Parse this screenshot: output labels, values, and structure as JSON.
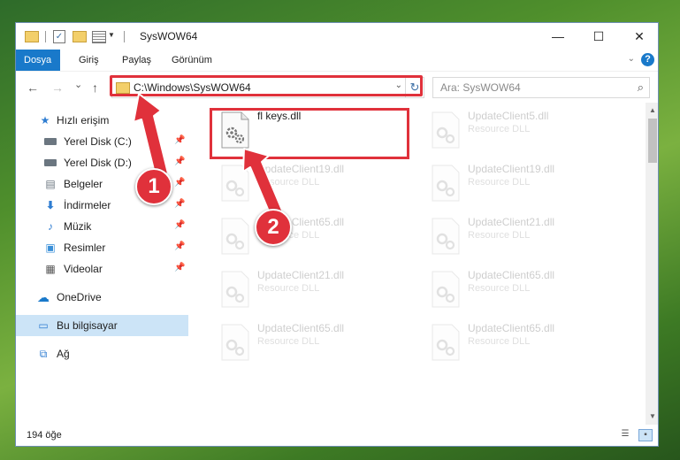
{
  "window": {
    "title": "SysWOW64",
    "controls": {
      "minimize": "—",
      "maximize": "☐",
      "close": "✕"
    }
  },
  "ribbon": {
    "tabs": [
      {
        "label": "Dosya",
        "active": true
      },
      {
        "label": "Giriş"
      },
      {
        "label": "Paylaş"
      },
      {
        "label": "Görünüm"
      }
    ],
    "help": "?"
  },
  "navigation": {
    "back_icon": "←",
    "forward_icon": "→",
    "recent_icon": "⌄",
    "up_icon": "↑",
    "address": "C:\\Windows\\SysWOW64",
    "search_placeholder": "Ara: SysWOW64"
  },
  "sidebar": {
    "items": [
      {
        "label": "Hızlı erişim",
        "icon": "star-icon"
      },
      {
        "label": "Yerel Disk (C:)",
        "icon": "drive-icon",
        "pinned": true
      },
      {
        "label": "Yerel Disk (D:)",
        "icon": "drive-icon",
        "pinned": true
      },
      {
        "label": "Belgeler",
        "icon": "documents-icon",
        "pinned": true
      },
      {
        "label": "İndirmeler",
        "icon": "downloads-icon",
        "pinned": true
      },
      {
        "label": "Müzik",
        "icon": "music-icon",
        "pinned": true
      },
      {
        "label": "Resimler",
        "icon": "pictures-icon",
        "pinned": true
      },
      {
        "label": "Videolar",
        "icon": "videos-icon",
        "pinned": true
      },
      {
        "label": "OneDrive",
        "icon": "onedrive-icon"
      },
      {
        "label": "Bu bilgisayar",
        "icon": "computer-icon",
        "selected": true
      },
      {
        "label": "Ağ",
        "icon": "network-icon"
      }
    ]
  },
  "files": [
    {
      "name": "fl keys.dll",
      "type": ""
    },
    {
      "name": "UpdateClient5.dll",
      "type": "Resource DLL"
    },
    {
      "name": "UpdateClient19.dll",
      "type": "Resource DLL"
    },
    {
      "name": "UpdateClient19.dll",
      "type": "Resource DLL"
    },
    {
      "name": "UpdateClient65.dll",
      "type": "Resource DLL"
    },
    {
      "name": "UpdateClient21.dll",
      "type": "Resource DLL"
    },
    {
      "name": "UpdateClient21.dll",
      "type": "Resource DLL"
    },
    {
      "name": "UpdateClient65.dll",
      "type": "Resource DLL"
    },
    {
      "name": "UpdateClient65.dll",
      "type": "Resource DLL"
    },
    {
      "name": "UpdateClient65.dll",
      "type": "Resource DLL"
    }
  ],
  "status": {
    "item_count": "194 öğe"
  },
  "callouts": [
    "1",
    "2"
  ],
  "colors": {
    "accent": "#1979ca",
    "highlight": "#e0313b",
    "selected": "#cce4f7"
  }
}
